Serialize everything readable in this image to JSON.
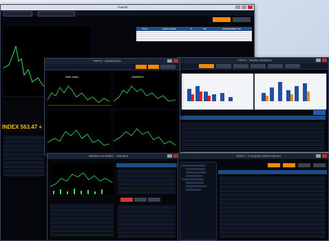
{
  "windows": {
    "main": {
      "title": "Overall"
    },
    "chart_window": {
      "title": "TinPro - MarketView"
    },
    "market_statistics": {
      "title": "TinPro - Market Statistics"
    },
    "market_list": {
      "title": "Market List Watch - VNIndex"
    },
    "company_explorer": {
      "title": "TinPro - Company Data Explorer"
    }
  },
  "main": {
    "symbol_select": "",
    "header_values": "",
    "volume_line": "",
    "index_line": "INDEX 563.47 + 1.",
    "buttons": [
      "",
      ""
    ],
    "table": {
      "headers": [
        "Time",
        "Latest Value",
        "+/-",
        "Vol",
        "Accumulated Vol"
      ],
      "rows": [
        [
          "",
          "",
          "",
          "",
          ""
        ],
        [
          "",
          "",
          "",
          "",
          ""
        ],
        [
          "",
          "",
          "",
          "",
          ""
        ],
        [
          "",
          "",
          "",
          "",
          ""
        ],
        [
          "",
          "",
          "",
          "",
          ""
        ]
      ]
    }
  },
  "chart_window": {
    "panels": [
      {
        "label": "HNX Index"
      },
      {
        "label": "VNINDEX"
      },
      {
        "label": ""
      },
      {
        "label": ""
      }
    ]
  },
  "market_statistics": {
    "tabs": [
      "",
      "",
      "",
      "",
      "",
      ""
    ]
  },
  "market_list": {
    "index_line": "",
    "tabs": [
      "",
      "",
      ""
    ]
  },
  "company_explorer": {
    "tabs": [
      "",
      "",
      "",
      ""
    ]
  }
}
